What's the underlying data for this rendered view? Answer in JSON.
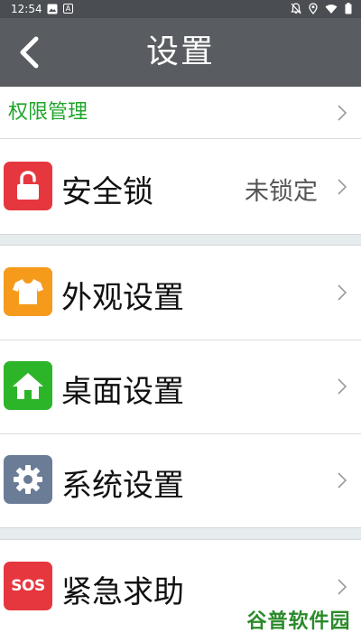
{
  "status_bar": {
    "time": "12:54",
    "left_icons": [
      "image-icon",
      "text-a-icon"
    ],
    "right_icons": [
      "bell-off-icon",
      "location-icon",
      "wifi-icon",
      "battery-icon"
    ],
    "a_glyph": "A"
  },
  "header": {
    "title": "设置",
    "back_icon": "chevron-left-icon"
  },
  "permission_row": {
    "label": "权限管理"
  },
  "rows": [
    {
      "label": "安全锁",
      "value": "未锁定",
      "icon": "lock-icon",
      "color": "#e6373f"
    },
    {
      "label": "外观设置",
      "icon": "tshirt-icon",
      "color": "#f59a1b"
    },
    {
      "label": "桌面设置",
      "icon": "home-icon",
      "color": "#2db52a"
    },
    {
      "label": "系统设置",
      "icon": "gear-icon",
      "color": "#6b7c96"
    },
    {
      "label": "紧急求助",
      "icon": "sos-icon",
      "icon_text": "SOS",
      "color": "#e6373f"
    }
  ],
  "colors": {
    "title_bar": "#595c60",
    "status_bar": "#4a4d52",
    "accent_green": "#1fa52b",
    "section_gap": "#e6ebee"
  },
  "watermark": {
    "text": "谷普软件园"
  }
}
